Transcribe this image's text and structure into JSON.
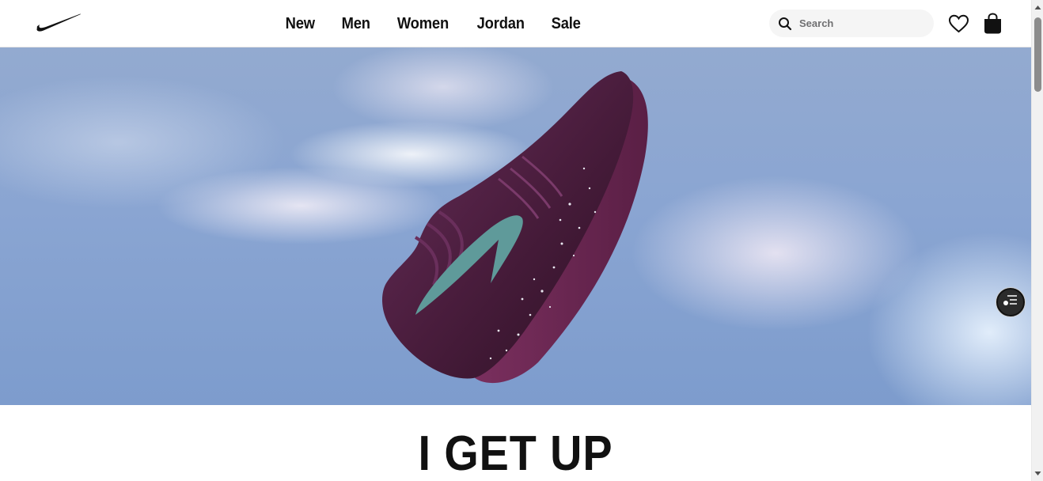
{
  "header": {
    "logo_icon": "swoosh-icon",
    "nav": [
      {
        "label": "New"
      },
      {
        "label": "Men"
      },
      {
        "label": "Women"
      },
      {
        "label": "Jordan"
      },
      {
        "label": "Sale"
      }
    ],
    "search": {
      "placeholder": "Search",
      "value": "",
      "icon": "search-icon"
    },
    "favorites_icon": "heart-icon",
    "bag_icon": "shopping-bag-icon"
  },
  "hero": {
    "image": "purple-basketball-shoe-against-sky",
    "filter_icon": "filter-list-icon"
  },
  "headline": "I GET UP",
  "colors": {
    "text": "#111111",
    "search_bg": "#f5f5f5",
    "sky": "#8aa5d2",
    "shoe": "#4a1d3d",
    "swoosh": "#5f9a9a"
  }
}
